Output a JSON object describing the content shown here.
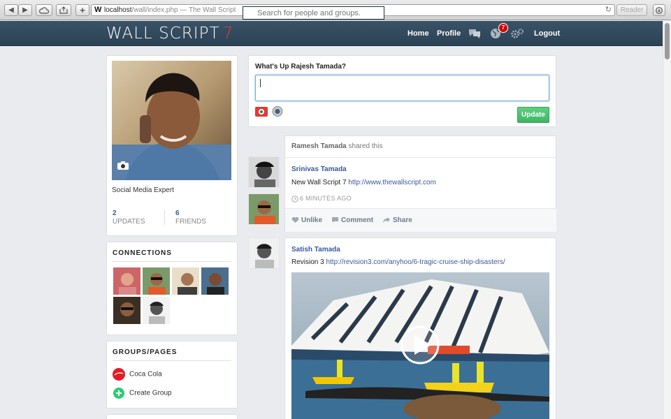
{
  "browser": {
    "url_host": "localhost",
    "url_path": "/wall/index.php",
    "page_title": "The Wall Script",
    "url_separator": " — ",
    "reader_label": "Reader",
    "favicon_letter": "W"
  },
  "header": {
    "logo_text": "WALL SCRIPT",
    "logo_version": "7",
    "search_placeholder": "Search for people and groups.",
    "nav": {
      "home": "Home",
      "profile": "Profile",
      "logout": "Logout"
    },
    "notification_count": "7"
  },
  "profile": {
    "tagline": "Social Media Expert",
    "stats": [
      {
        "value": "2",
        "label": "UPDATES"
      },
      {
        "value": "6",
        "label": "FRIENDS"
      }
    ]
  },
  "connections": {
    "title": "CONNECTIONS",
    "count": 6
  },
  "groups": {
    "title": "GROUPS/PAGES",
    "items": [
      {
        "label": "Coca Cola",
        "icon": "coca-cola-logo-icon"
      },
      {
        "label": "Create Group",
        "icon": "plus-circle-icon"
      }
    ]
  },
  "composer": {
    "prompt": "What's Up Rajesh Tamada?",
    "update_label": "Update"
  },
  "feed": [
    {
      "shared_by": "Ramesh Tamada",
      "shared_suffix": " shared this",
      "author": "Srinivas Tamada",
      "text": "New Wall Script 7 ",
      "link": "http://www.thewallscript.com",
      "time": "6 MINUTES AGO",
      "actions": {
        "unlike": "Unlike",
        "comment": "Comment",
        "share": "Share"
      }
    },
    {
      "author": "Satish Tamada",
      "text": "Revision 3 ",
      "link": "http://revision3.com/anyhoo/6-tragic-cruise-ship-disasters/"
    }
  ],
  "colors": {
    "header_bg": "#2f475b",
    "link": "#3b5998",
    "accent_red": "#e23b2f",
    "update_green": "#3cb664",
    "badge_red": "#d70000"
  }
}
